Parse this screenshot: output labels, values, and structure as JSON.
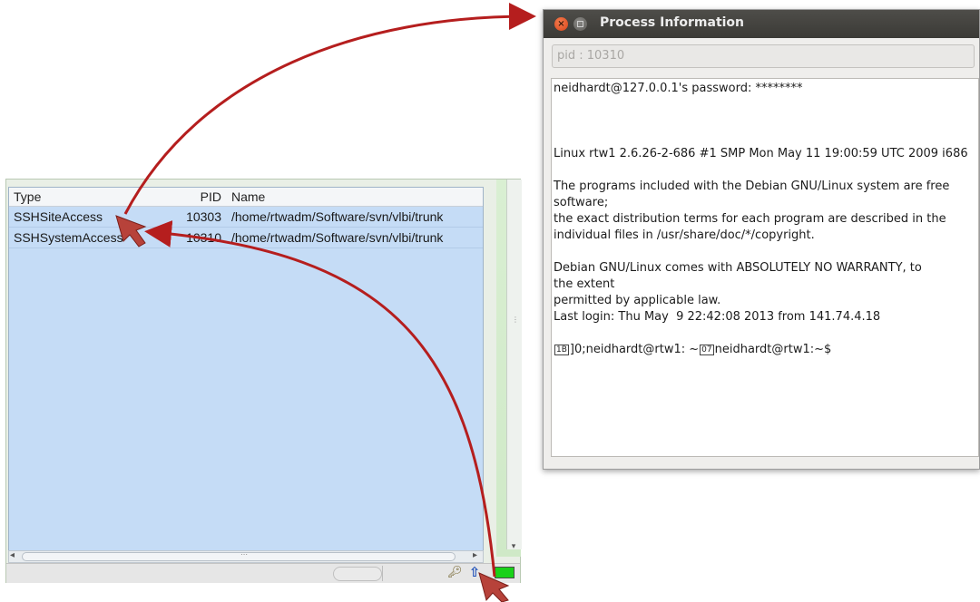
{
  "process_table": {
    "columns": {
      "type": "Type",
      "pid": "PID",
      "name": "Name"
    },
    "rows": [
      {
        "type": "SSHSiteAccess",
        "pid": "10303",
        "name": "/home/rtwadm/Software/svn/vlbi/trunk"
      },
      {
        "type": "SSHSystemAccess",
        "pid": "10310",
        "name": "/home/rtwadm/Software/svn/vlbi/trunk"
      }
    ]
  },
  "status_bar": {
    "icons": [
      "key-icon",
      "up-arrow-icon"
    ],
    "led_color": "#19d119"
  },
  "info_window": {
    "title": "Process Information",
    "pid_field": "pid : 10310",
    "lines": [
      "neidhardt@127.0.0.1's password: ********",
      "",
      "",
      "",
      "Linux rtw1 2.6.26-2-686 #1 SMP Mon May 11 19:00:59 UTC 2009 i686",
      "",
      "The programs included with the Debian GNU/Linux system are free",
      "software;",
      "the exact distribution terms for each program are described in the",
      "individual files in /usr/share/doc/*/copyright.",
      "",
      "Debian GNU/Linux comes with ABSOLUTELY NO WARRANTY, to",
      "the extent",
      "permitted by applicable law.",
      "Last login: Thu May  9 22:42:08 2013 from 141.74.4.18",
      ""
    ],
    "prompt_parts": [
      "]0;neidhardt@rtw1: ~",
      "neidhardt@rtw1:~$"
    ]
  },
  "colors": {
    "arrow": "#b51e1e",
    "selection": "#c5dcf6",
    "titlebar": "#3f3e3a"
  }
}
